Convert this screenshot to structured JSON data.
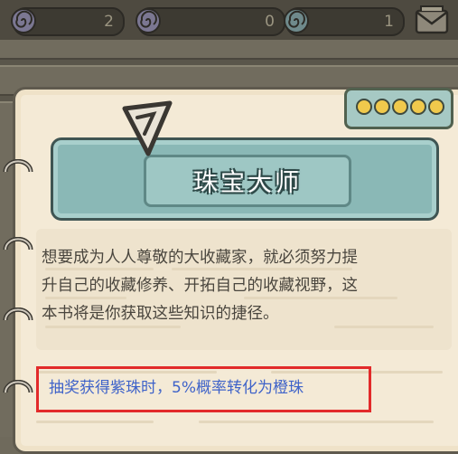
{
  "currencies": [
    {
      "icon": "swirl-shell-icon",
      "value": "2"
    },
    {
      "icon": "swirl-shell-icon",
      "value": "0"
    },
    {
      "icon": "swirl-shell-icon",
      "value": "1"
    }
  ],
  "mail_icon": "mail-icon",
  "book": {
    "title": "珠宝大师",
    "description_lines": [
      "想要成为人人尊敬的大收藏家，就必须努力提",
      "升自己的收藏修养、开拓自己的收藏视野，这",
      "本书将是你获取这些知识的捷径。"
    ],
    "effect": "抽奖获得紫珠时，5%概率转化为橙珠",
    "tab_dots": 5
  },
  "colors": {
    "highlight_border": "#e22a2a",
    "effect_text": "#3f63c9",
    "banner": "#8ab8b6",
    "page": "#f4ead6",
    "dot": "#f0c94c"
  }
}
